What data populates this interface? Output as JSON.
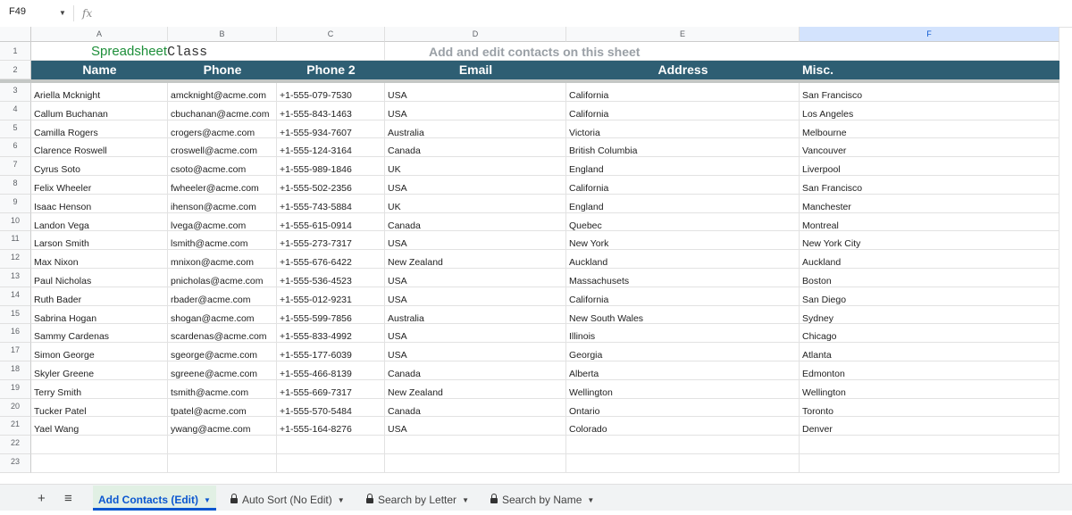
{
  "formula_bar": {
    "name_box": "F49",
    "fx_icon": "fx"
  },
  "columns": [
    {
      "letter": "A",
      "selected": false
    },
    {
      "letter": "B",
      "selected": false
    },
    {
      "letter": "C",
      "selected": false
    },
    {
      "letter": "D",
      "selected": false
    },
    {
      "letter": "E",
      "selected": false
    },
    {
      "letter": "F",
      "selected": true
    }
  ],
  "row_numbers": [
    "1",
    "2",
    "3",
    "4",
    "5",
    "6",
    "7",
    "8",
    "9",
    "10",
    "11",
    "12",
    "13",
    "14",
    "15",
    "16",
    "17",
    "18",
    "19",
    "20",
    "21",
    "22",
    "23"
  ],
  "sheet": {
    "brand_part1": "Spreadsheet",
    "brand_part2": "Class",
    "subtitle": "Add and edit contacts on this sheet",
    "header_color": "#2e5e73",
    "headers": [
      "Name",
      "Phone",
      "Phone 2",
      "Email",
      "Address",
      "Misc."
    ],
    "rows": [
      [
        "Ariella Mcknight",
        "amcknight@acme.com",
        "+1-555-079-7530",
        "USA",
        "California",
        "San Francisco"
      ],
      [
        "Callum Buchanan",
        "cbuchanan@acme.com",
        "+1-555-843-1463",
        "USA",
        "California",
        "Los Angeles"
      ],
      [
        "Camilla Rogers",
        "crogers@acme.com",
        "+1-555-934-7607",
        "Australia",
        "Victoria",
        "Melbourne"
      ],
      [
        "Clarence Roswell",
        "croswell@acme.com",
        "+1-555-124-3164",
        "Canada",
        "British Columbia",
        "Vancouver"
      ],
      [
        "Cyrus Soto",
        "csoto@acme.com",
        "+1-555-989-1846",
        "UK",
        "England",
        "Liverpool"
      ],
      [
        "Felix Wheeler",
        "fwheeler@acme.com",
        "+1-555-502-2356",
        "USA",
        "California",
        "San Francisco"
      ],
      [
        "Isaac Henson",
        "ihenson@acme.com",
        "+1-555-743-5884",
        "UK",
        "England",
        "Manchester"
      ],
      [
        "Landon Vega",
        "lvega@acme.com",
        "+1-555-615-0914",
        "Canada",
        "Quebec",
        "Montreal"
      ],
      [
        "Larson Smith",
        "lsmith@acme.com",
        "+1-555-273-7317",
        "USA",
        "New York",
        "New York City"
      ],
      [
        "Max Nixon",
        "mnixon@acme.com",
        "+1-555-676-6422",
        "New Zealand",
        "Auckland",
        "Auckland"
      ],
      [
        "Paul Nicholas",
        "pnicholas@acme.com",
        "+1-555-536-4523",
        "USA",
        "Massachusets",
        "Boston"
      ],
      [
        "Ruth Bader",
        "rbader@acme.com",
        "+1-555-012-9231",
        "USA",
        "California",
        "San Diego"
      ],
      [
        "Sabrina Hogan",
        "shogan@acme.com",
        "+1-555-599-7856",
        "Australia",
        "New South Wales",
        "Sydney"
      ],
      [
        "Sammy Cardenas",
        "scardenas@acme.com",
        "+1-555-833-4992",
        "USA",
        "Illinois",
        "Chicago"
      ],
      [
        "Simon George",
        "sgeorge@acme.com",
        "+1-555-177-6039",
        "USA",
        "Georgia",
        "Atlanta"
      ],
      [
        "Skyler Greene",
        "sgreene@acme.com",
        "+1-555-466-8139",
        "Canada",
        "Alberta",
        "Edmonton"
      ],
      [
        "Terry Smith",
        "tsmith@acme.com",
        "+1-555-669-7317",
        "New Zealand",
        "Wellington",
        "Wellington"
      ],
      [
        "Tucker Patel",
        "tpatel@acme.com",
        "+1-555-570-5484",
        "Canada",
        "Ontario",
        "Toronto"
      ],
      [
        "Yael Wang",
        "ywang@acme.com",
        "+1-555-164-8276",
        "USA",
        "Colorado",
        "Denver"
      ],
      [
        "",
        "",
        "",
        "",
        "",
        ""
      ],
      [
        "",
        "",
        "",
        "",
        "",
        ""
      ]
    ]
  },
  "tabbar": {
    "add_icon": "+",
    "menu_icon": "≡",
    "tabs": [
      {
        "label": "Add Contacts (Edit)",
        "locked": false,
        "active": true
      },
      {
        "label": "Auto Sort (No Edit)",
        "locked": true,
        "active": false
      },
      {
        "label": "Search by Letter",
        "locked": true,
        "active": false
      },
      {
        "label": "Search by Name",
        "locked": true,
        "active": false
      }
    ]
  }
}
